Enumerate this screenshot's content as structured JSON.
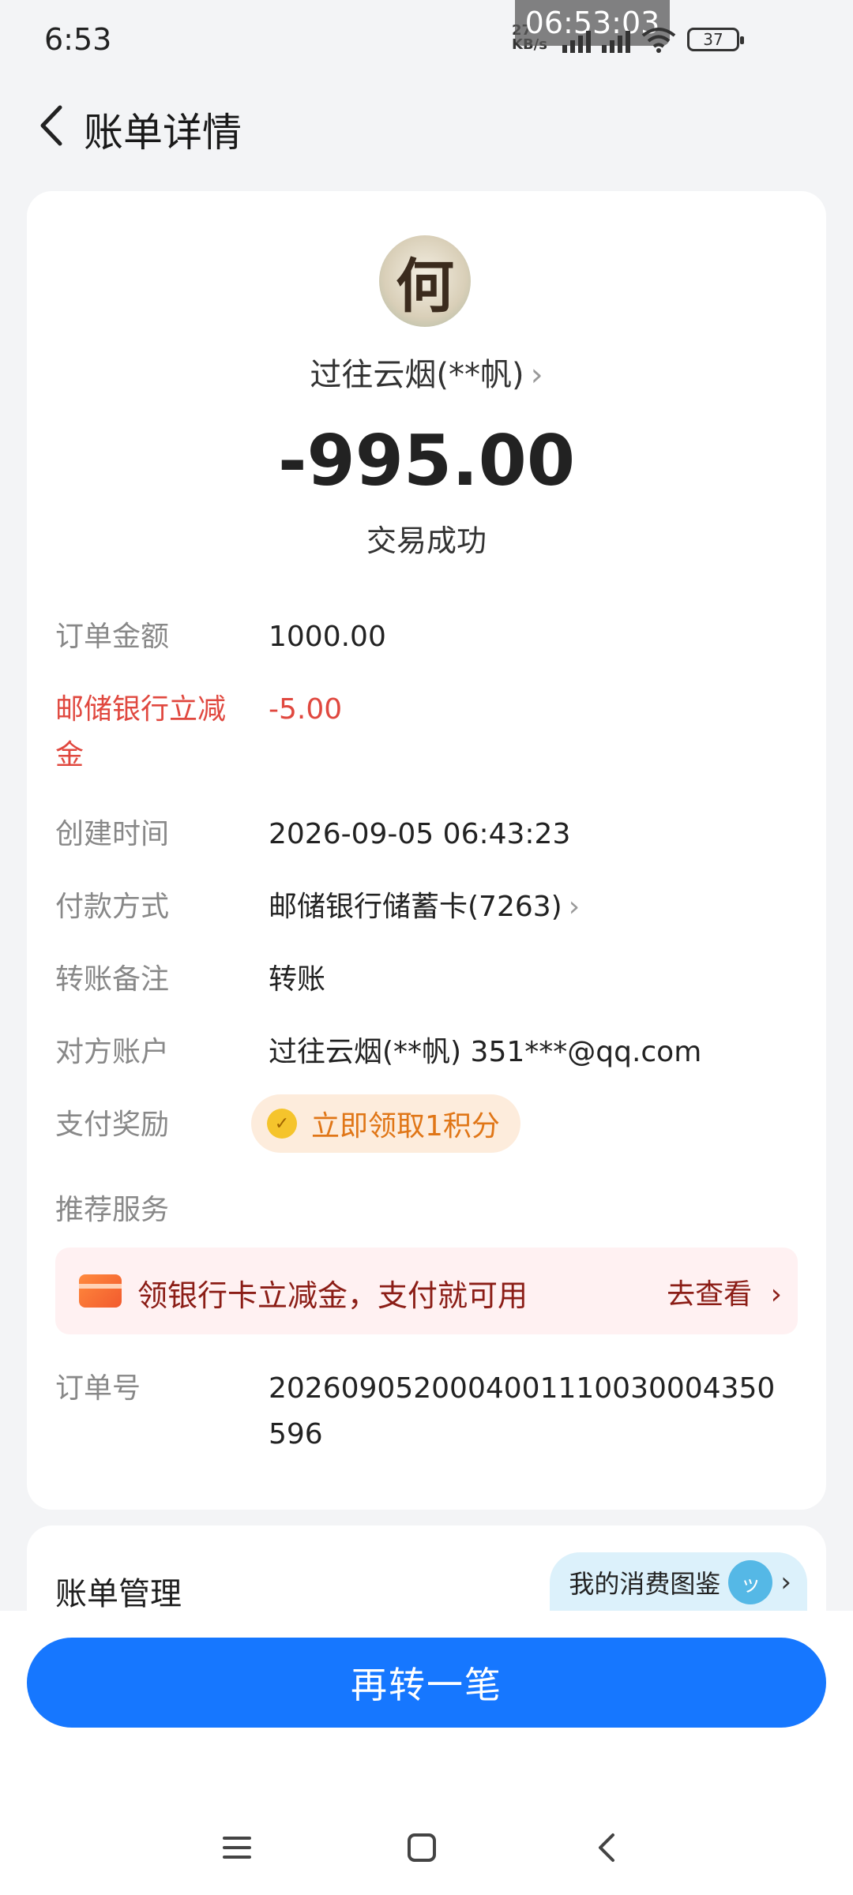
{
  "status_bar": {
    "time": "6:53",
    "recording_time": "06:53:03",
    "net_speed_value": "27",
    "net_speed_unit": "KB/s",
    "battery": "37"
  },
  "header": {
    "title": "账单详情"
  },
  "payee": {
    "name": "过往云烟(**帆)",
    "avatar_glyph": "何"
  },
  "amount": "-995.00",
  "status": "交易成功",
  "details": [
    {
      "label": "订单金额",
      "value": "1000.00"
    },
    {
      "label": "邮储银行立减金",
      "value": "-5.00",
      "highlight": true
    },
    {
      "label": "创建时间",
      "value": "2026-09-05 06:43:23"
    },
    {
      "label": "付款方式",
      "value": "邮储银行储蓄卡(7263)"
    },
    {
      "label": "转账备注",
      "value": "转账"
    },
    {
      "label": "对方账户",
      "value": "过往云烟(**帆) 351***@qq.com"
    },
    {
      "label": "支付奖励",
      "value": "立即领取1积分"
    },
    {
      "label": "推荐服务",
      "value": ""
    },
    {
      "label": "订单号",
      "value": "2026090520004001110030004350596"
    }
  ],
  "promo": {
    "text": "领银行卡立减金，支付就可用",
    "link": "去查看"
  },
  "bill_management": {
    "title": "账单管理",
    "spend_atlas": "我的消费图鉴"
  },
  "primary_action": {
    "label": "再转一笔"
  },
  "colors": {
    "primary": "#1677ff",
    "discount_red": "#e0483f",
    "reward_orange": "#e07617"
  },
  "icons": [
    "back-icon",
    "chevron-right-icon",
    "coin-icon",
    "bank-card-icon",
    "menu-icon",
    "home-square-icon",
    "nav-back-icon"
  ]
}
